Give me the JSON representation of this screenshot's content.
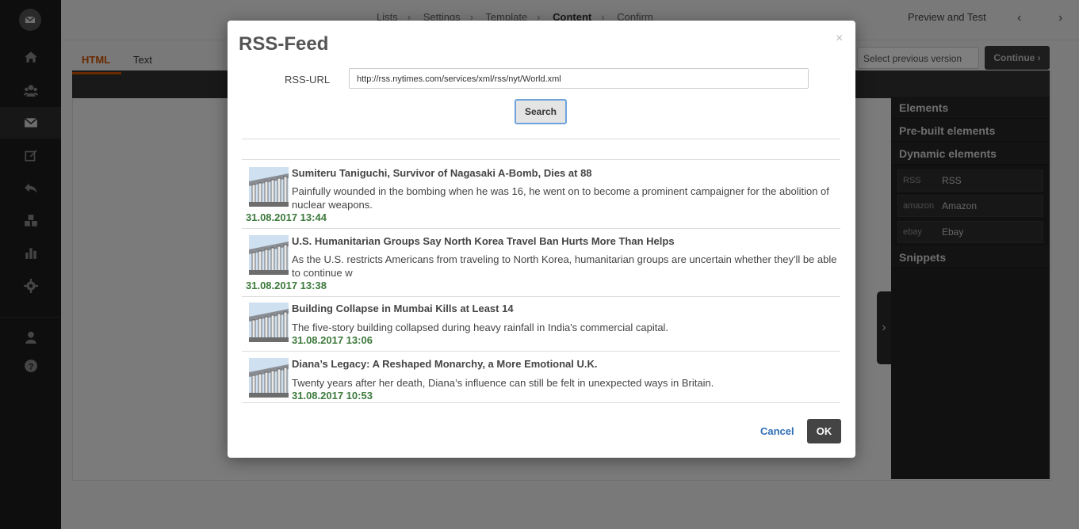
{
  "steps": [
    "Lists",
    "Settings",
    "Template",
    "Content",
    "Confirm"
  ],
  "current_step": "Content",
  "preview_label": "Preview and Test",
  "editor_tabs": [
    "HTML",
    "Text"
  ],
  "version_select": "Select previous version",
  "continue_label": "Continue",
  "right_panel": {
    "elements": "Elements",
    "prebuilt": "Pre-built elements",
    "dynamic": "Dynamic elements",
    "items": [
      {
        "brand": "RSS",
        "label": "RSS"
      },
      {
        "brand": "amazon",
        "label": "Amazon"
      },
      {
        "brand": "ebay",
        "label": "Ebay"
      }
    ],
    "snippets": "Snippets"
  },
  "modal": {
    "title": "RSS-Feed",
    "close": "×",
    "url_label": "RSS-URL",
    "url_value": "http://rss.nytimes.com/services/xml/rss/nyt/World.xml",
    "search_label": "Search",
    "items": [
      {
        "title": "Sumiteru Taniguchi, Survivor of Nagasaki A-Bomb, Dies at 88",
        "desc": "Painfully wounded in the bombing when he was 16, he went on to become a prominent campaigner for the abolition of nuclear weapons.",
        "date": "31.08.2017 13:44"
      },
      {
        "title": "U.S. Humanitarian Groups Say North Korea Travel Ban Hurts More Than Helps",
        "desc": "As the U.S. restricts Americans from traveling to North Korea, humanitarian groups are uncertain whether they'll be able to continue w",
        "date": "31.08.2017 13:38"
      },
      {
        "title": "Building Collapse in Mumbai Kills at Least 14",
        "desc": "The five-story building collapsed during heavy rainfall in India's commercial capital.",
        "date": "31.08.2017 13:06"
      },
      {
        "title": "Diana’s Legacy: A Reshaped Monarchy, a More Emotional U.K.",
        "desc": "Twenty years after her death, Diana’s influence can still be felt in unexpected ways in Britain.",
        "date": "31.08.2017 10:53"
      }
    ],
    "cancel_label": "Cancel",
    "ok_label": "OK"
  }
}
